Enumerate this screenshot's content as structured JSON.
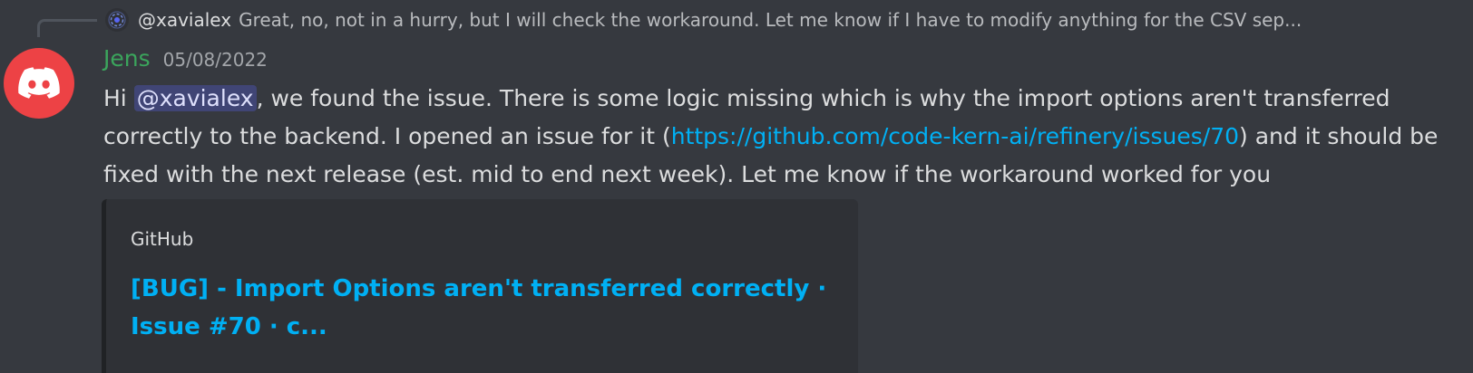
{
  "reply": {
    "author": "@xavialex",
    "text": "Great, no, not in a hurry, but I will check the workaround. Let me know if I have to modify anything for the CSV sep..."
  },
  "message": {
    "author": "Jens",
    "timestamp": "05/08/2022",
    "author_color": "#3ba55c",
    "avatar_color": "#ed4245",
    "avatar_icon": "discord-logo-icon",
    "text_before_mention": "Hi ",
    "mention": "@xavialex",
    "text_after_mention": ", we found the issue. There is some logic missing which is why the import options aren't transferred correctly to the backend. I opened an issue for it (",
    "link": "https://github.com/code-kern-ai/refinery/issues/70",
    "text_after_link": ") and it should be fixed with the next release (est. mid to end next week). Let me know if the workaround worked for you"
  },
  "embed": {
    "provider": "GitHub",
    "title": "[BUG] - Import Options aren't transferred correctly · Issue #70 · c..."
  },
  "colors": {
    "background": "#36393f",
    "link": "#00b0f4",
    "embed_background": "#2f3136"
  }
}
